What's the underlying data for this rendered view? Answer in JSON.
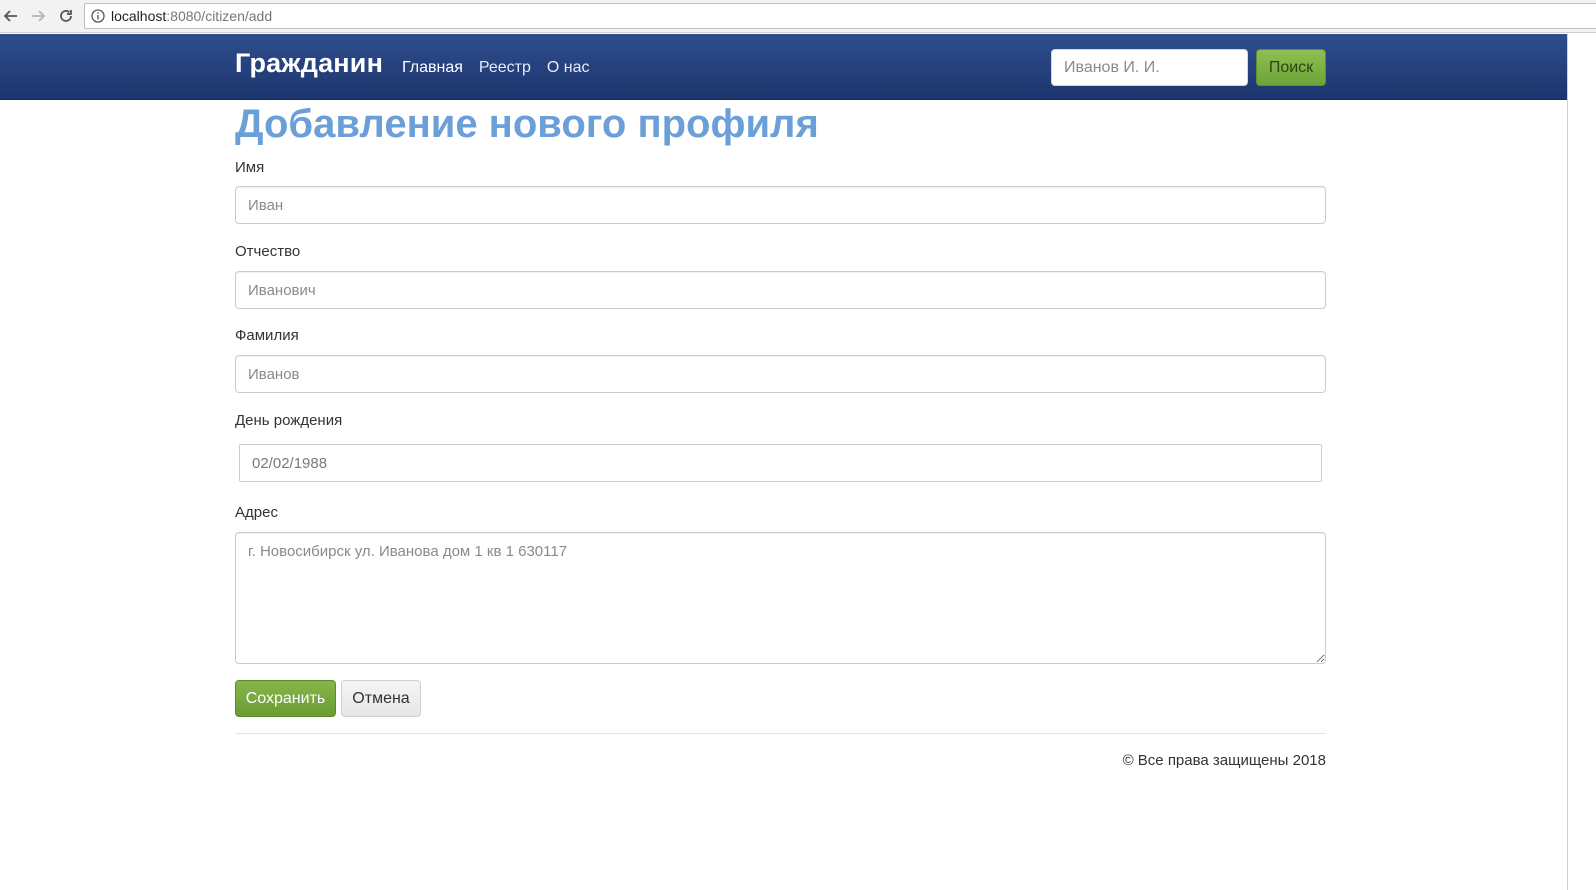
{
  "browser": {
    "url_host": "localhost",
    "url_path": ":8080/citizen/add"
  },
  "navbar": {
    "brand": "Гражданин",
    "links": [
      {
        "label": "Главная"
      },
      {
        "label": "Реестр"
      },
      {
        "label": "О нас"
      }
    ],
    "search_placeholder": "Иванов И. И.",
    "search_button": "Поиск"
  },
  "form": {
    "title": "Добавление нового профиля",
    "first_name": {
      "label": "Имя",
      "placeholder": "Иван"
    },
    "patronymic": {
      "label": "Отчество",
      "placeholder": "Иванович"
    },
    "last_name": {
      "label": "Фамилия",
      "placeholder": "Иванов"
    },
    "birthday": {
      "label": "День рождения",
      "placeholder": "02/02/1988"
    },
    "address": {
      "label": "Адрес",
      "placeholder": "г. Новосибирск ул. Иванова дом 1 кв 1 630117"
    },
    "save_button": "Сохранить",
    "cancel_button": "Отмена"
  },
  "footer": {
    "copyright": "© Все права защищены 2018"
  },
  "colors": {
    "navbar": "#1d356d",
    "title": "#6a9fd8",
    "success": "#6b9c35"
  }
}
